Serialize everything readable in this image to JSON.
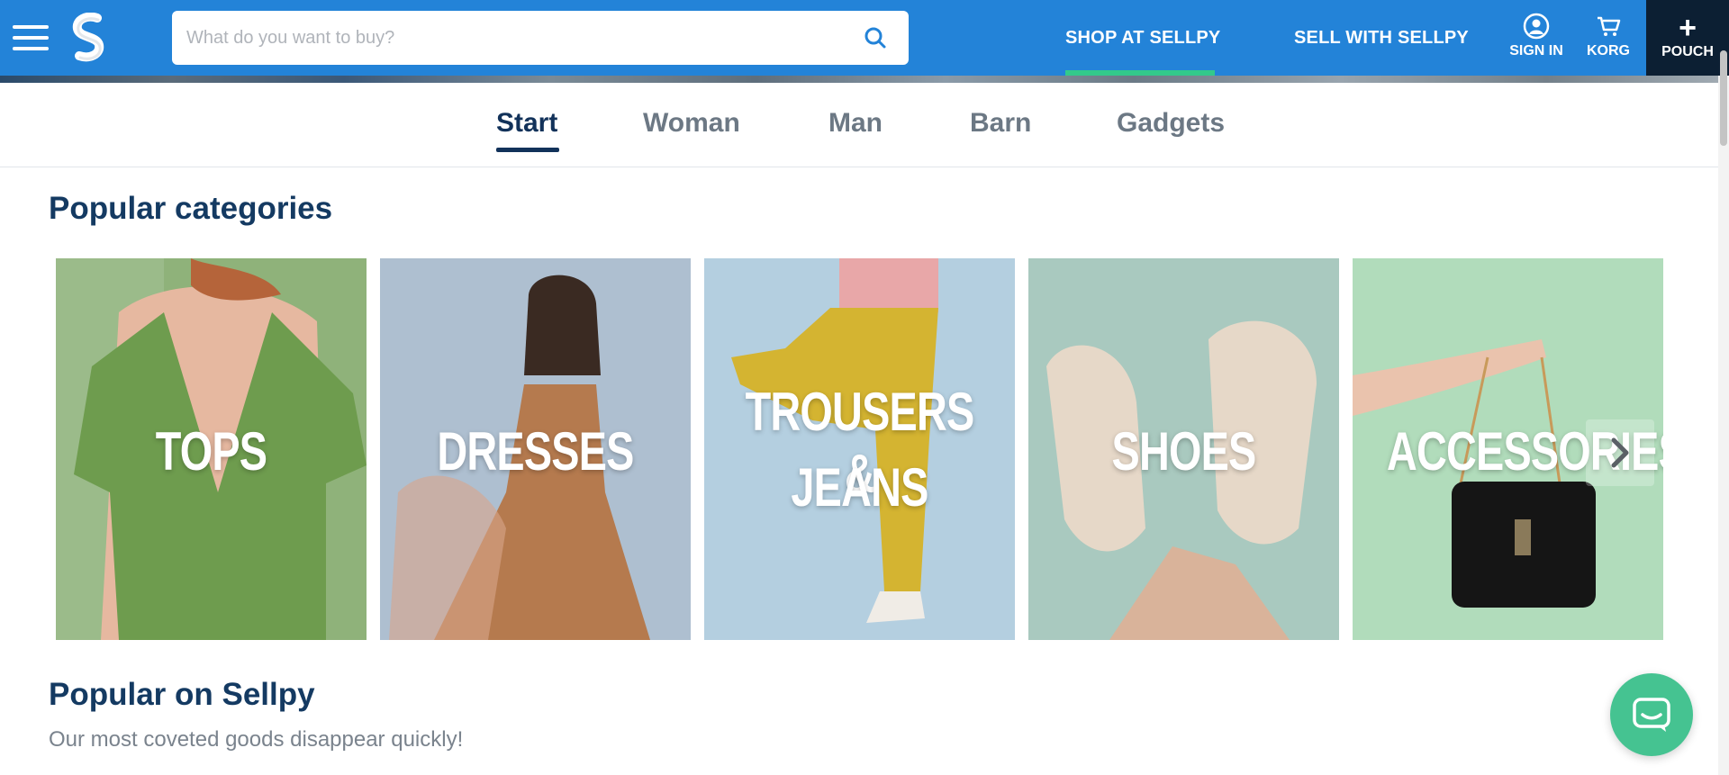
{
  "header": {
    "search": {
      "placeholder": "What do you want to buy?",
      "value": ""
    },
    "nav": {
      "shop_label": "SHOP AT SELLPY",
      "sell_label": "SELL WITH SELLPY"
    },
    "actions": {
      "signin_label": "SIGN IN",
      "cart_label": "KORG",
      "pouch_label": "POUCH",
      "pouch_plus": "+"
    }
  },
  "tabs": [
    {
      "label": "Start",
      "active": true
    },
    {
      "label": "Woman",
      "active": false
    },
    {
      "label": "Man",
      "active": false
    },
    {
      "label": "Barn",
      "active": false
    },
    {
      "label": "Gadgets",
      "active": false
    }
  ],
  "popular_categories": {
    "title": "Popular categories",
    "cards": [
      {
        "label": "TOPS",
        "bg": "#7aa768"
      },
      {
        "label": "DRESSES",
        "bg": "#9fb4c9"
      },
      {
        "label_line1": "TROUSERS &",
        "label_line2": "JEANS",
        "bg": "#a9c7dc"
      },
      {
        "label": "SHOES",
        "bg": "#9ec1b6"
      },
      {
        "label": "ACCESSORIES",
        "bg": "#a8d8b4"
      }
    ]
  },
  "popular_on_sellpy": {
    "title": "Popular on Sellpy",
    "subtitle": "Our most coveted goods disappear quickly!"
  },
  "colors": {
    "brand_blue": "#2383d8",
    "active_underline": "#33c98b",
    "chat_green": "#45c391",
    "pouch_dark": "#0c1f33",
    "heading": "#143a62"
  },
  "icons": [
    "menu-icon",
    "sellpy-logo",
    "search-icon",
    "user-icon",
    "cart-icon",
    "plus-icon",
    "chevron-right-icon",
    "chat-icon"
  ]
}
